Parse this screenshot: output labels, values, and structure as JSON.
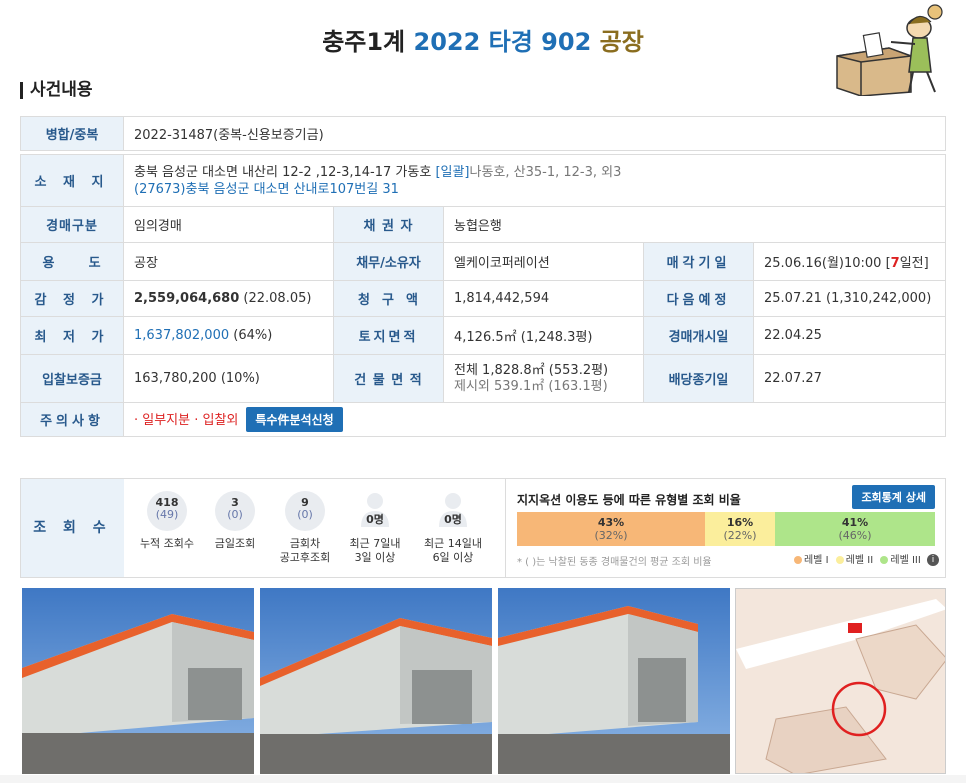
{
  "header": {
    "court": "충주1계",
    "case_no": "2022 타경 902",
    "prop_type": "공장"
  },
  "section": {
    "title": "사건내용"
  },
  "info": {
    "merge_label": "병합/중복",
    "merge_value": "2022-31487(중복-신용보증기금)",
    "location_label": "소 재 지",
    "location_line1": "충북 음성군 대소면 내산리 12-2 ,12-3,14-17 가동호",
    "location_bulk": "[일괄]",
    "location_rest": "나동호, 산35-1, 12-3, 외3",
    "location_line2": "(27673)충북 음성군  대소면 산내로107번길  31",
    "auction_type_label": "경매구분",
    "auction_type": "임의경매",
    "creditor_label": "채 권 자",
    "creditor": "농협은행",
    "usage_label": "용      도",
    "usage": "공장",
    "debtor_label": "채무/소유자",
    "debtor": "엘케이코퍼레이션",
    "sale_date_label": "매각기일",
    "sale_date": "25.06.16(월)10:00 [",
    "sale_date_days": "7",
    "sale_date_end": "일전]",
    "appraisal_label": "감 정 가",
    "appraisal_value": "2,559,064,680",
    "appraisal_date": " (22.08.05)",
    "claim_label": "청  구  액",
    "claim": "1,814,442,594",
    "next_label": "다음예정",
    "next": "25.07.21 (1,310,242,000)",
    "min_label": "최 저 가",
    "min_value": "1,637,802,000",
    "min_pct": " (64%)",
    "land_label": "토지면적",
    "land": "4,126.5㎡ (1,248.3평)",
    "start_label": "경매개시일",
    "start": "22.04.25",
    "deposit_label": "입찰보증금",
    "deposit": "163,780,200 (10%)",
    "building_label": "건 물 면 적",
    "building1": "전체 1,828.8㎡ (553.2평)",
    "building2": "제시외 539.1㎡ (163.1평)",
    "dividend_label": "배당종기일",
    "dividend": "22.07.27",
    "caution_label": "주의사항",
    "caution": "· 일부지분 · 입찰외",
    "caution_btn": "특수件분석신청"
  },
  "stats": {
    "label": "조 회 수",
    "items": [
      {
        "n": "418",
        "s": "(49)",
        "cap": "누적 조회수"
      },
      {
        "n": "3",
        "s": "(0)",
        "cap": "금일조회"
      },
      {
        "n": "9",
        "s": "(0)",
        "cap1": "금회차",
        "cap2": "공고후조회"
      },
      {
        "n": "0명",
        "cap1": "최근 7일내",
        "cap2": "3일 이상"
      },
      {
        "n": "0명",
        "cap1": "최근 14일내",
        "cap2": "6일 이상"
      }
    ],
    "ratio_title": "지지옥션 이용도 등에 따른 유형별 조회 비율",
    "ratio_btn": "조회통계 상세",
    "bars": [
      {
        "p": "43%",
        "q": "(32%)",
        "color": "#f7b777"
      },
      {
        "p": "16%",
        "q": "(22%)",
        "color": "#fbee9c"
      },
      {
        "p": "41%",
        "q": "(46%)",
        "color": "#aee58a"
      }
    ],
    "note": "* ( )는 낙찰된 동종 경매물건의 평균 조회 비율",
    "legend": [
      "레벨 I",
      "레벨 II",
      "레벨 III"
    ]
  }
}
